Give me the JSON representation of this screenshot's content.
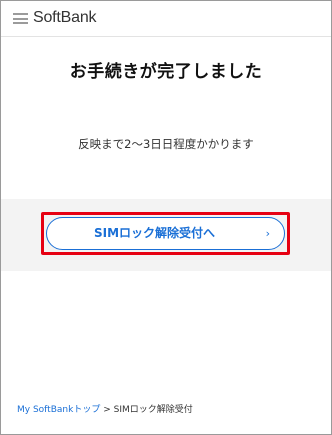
{
  "header": {
    "brand": "SoftBank",
    "menu_icon": "hamburger-menu-icon"
  },
  "main": {
    "title": "お手続きが完了しました",
    "message": "反映まで2～3日日程度かかります",
    "action_button": {
      "label": "SIMロック解除受付へ",
      "chevron": "›",
      "icon": "chevron-right-icon"
    }
  },
  "breadcrumb": {
    "home_link": "My SoftBankトップ",
    "separator": ">",
    "current": "SIMロック解除受付"
  },
  "colors": {
    "accent": "#1a6fd6",
    "highlight_border": "#e60012",
    "band_background": "#f3f3f3",
    "text": "#111111"
  }
}
